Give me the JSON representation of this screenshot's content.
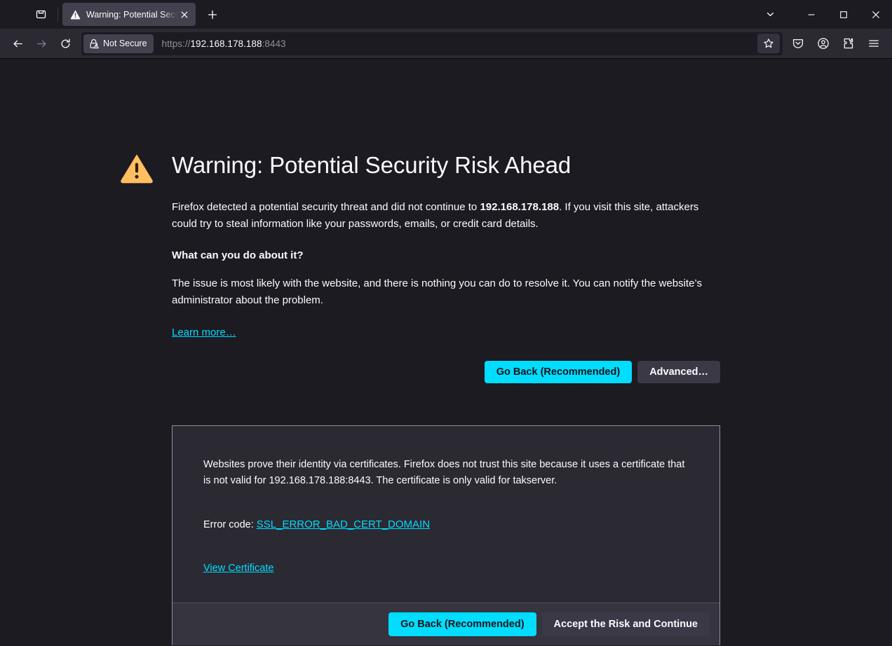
{
  "browser": {
    "tab": {
      "title": "Warning: Potential Security Risk Ahead",
      "favicon_icon": "warning-triangle-icon",
      "close_icon": "close-icon"
    },
    "newtab_icon": "plus-icon",
    "tab_list_icon": "list-all-tabs-icon",
    "window_controls": {
      "tab_overflow_icon": "chevron-down-icon",
      "minimize_icon": "minimize-icon",
      "maximize_icon": "maximize-icon",
      "close_icon": "close-icon"
    },
    "nav": {
      "back_icon": "arrow-left-icon",
      "forward_icon": "arrow-right-icon",
      "reload_icon": "reload-icon"
    },
    "urlbar": {
      "security_badge": "Not Secure",
      "security_icon": "lock-warning-icon",
      "url_scheme": "https://",
      "url_host": "192.168.178.188",
      "url_port": ":8443",
      "full_url": "https://192.168.178.188:8443",
      "bookmark_icon": "star-icon"
    },
    "toolbar": {
      "pocket_icon": "pocket-icon",
      "account_icon": "account-circle-icon",
      "extensions_icon": "extensions-puzzle-icon",
      "menu_icon": "hamburger-menu-icon"
    }
  },
  "error_page": {
    "warning_icon": "warning-triangle-icon",
    "title": "Warning: Potential Security Risk Ahead",
    "intro_before": "Firefox detected a potential security threat and did not continue to ",
    "intro_host": "192.168.178.188",
    "intro_after": ". If you visit this site, attackers could try to steal information like your passwords, emails, or credit card details.",
    "subheading": "What can you do about it?",
    "advice": "The issue is most likely with the website, and there is nothing you can do to resolve it. You can notify the website’s administrator about the problem.",
    "learn_more": "Learn more…",
    "go_back_label": "Go Back (Recommended)",
    "advanced_label": "Advanced…",
    "cert_panel": {
      "explanation": "Websites prove their identity via certificates. Firefox does not trust this site because it uses a certificate that is not valid for 192.168.178.188:8443. The certificate is only valid for takserver.",
      "error_code_label": "Error code: ",
      "error_code": "SSL_ERROR_BAD_CERT_DOMAIN",
      "view_certificate": "View Certificate",
      "go_back_label": "Go Back (Recommended)",
      "accept_risk_label": "Accept the Risk and Continue"
    }
  },
  "colors": {
    "accent_primary": "#00ddff",
    "warning_amber": "#ffbf5f",
    "page_bg": "#1c1b22",
    "panel_bg": "#2b2a33",
    "chrome_bg": "#2b2a33",
    "tab_active_bg": "#42414d",
    "text": "#fbfbfe",
    "text_dim": "#8f8f9d"
  }
}
